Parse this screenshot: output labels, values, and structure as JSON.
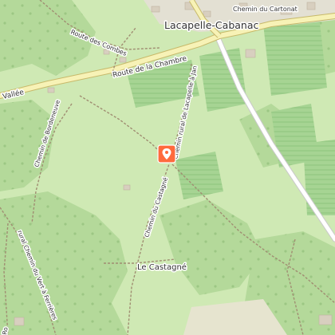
{
  "map": {
    "place_labels": {
      "village": "Lacapelle-Cabanac",
      "hamlet": "Le Castagné"
    },
    "road_labels": {
      "cartonat": "Chemin du Cartonat",
      "combes": "Route des Combes",
      "chambre": "Route de la Chambre",
      "vallee": "Vallée",
      "bordeneuve": "Chemin de Bordeneuve",
      "lacapelle": "Chemin rural de Lacapelle à Jan",
      "castagne": "Chemin du Castagné",
      "ferrieres": "rural Chemin du Vert à Ferrières",
      "left_edge": "Ro"
    },
    "marker": {
      "icon": "map-pin-icon",
      "color": "#ff6a3d"
    },
    "colors": {
      "grass": "#cfe9b4",
      "forest": "#aed492",
      "vineyard": "#9fd18c",
      "road_casing": "#c7b96a",
      "road_fill": "#f7f2b6",
      "white_road": "#ffffff",
      "track": "#a08e72"
    }
  }
}
